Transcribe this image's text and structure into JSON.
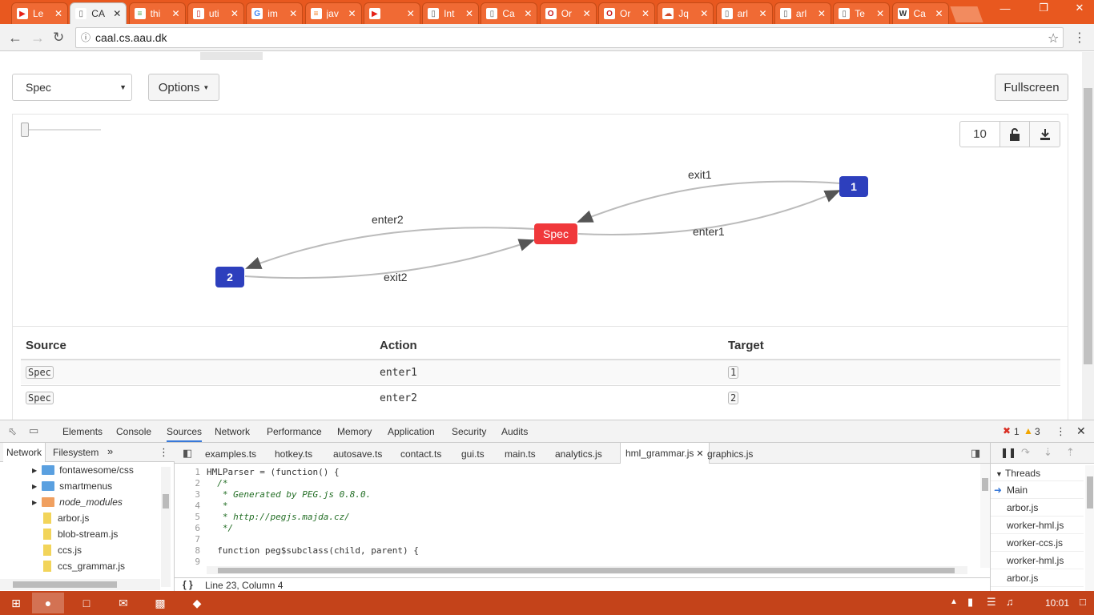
{
  "browser": {
    "tabs": [
      {
        "title": "Le",
        "icon": "youtube-icon",
        "color": "#e62117"
      },
      {
        "title": "CA",
        "icon": "page-icon",
        "color": "#666666"
      },
      {
        "title": "thi",
        "icon": "stackexchange-icon",
        "color": "#53a852"
      },
      {
        "title": "uti",
        "icon": "page-icon",
        "color": "#c8302e"
      },
      {
        "title": "im",
        "icon": "google-icon",
        "color": "#4285f4"
      },
      {
        "title": "jav",
        "icon": "stackoverflow-icon",
        "color": "#f48024"
      },
      {
        "title": "",
        "icon": "youtube-icon",
        "color": "#e62117"
      },
      {
        "title": "Int",
        "icon": "page-icon",
        "color": "#666666"
      },
      {
        "title": "Ca",
        "icon": "page-icon",
        "color": "#666666"
      },
      {
        "title": "Or",
        "icon": "opera-icon",
        "color": "#cc2020"
      },
      {
        "title": "Or",
        "icon": "opera-icon",
        "color": "#cc2020"
      },
      {
        "title": "Jq",
        "icon": "jquery-icon",
        "color": "#d04a2a"
      },
      {
        "title": "arl",
        "icon": "page-icon",
        "color": "#666666"
      },
      {
        "title": "arl",
        "icon": "page-icon",
        "color": "#666666"
      },
      {
        "title": "Te",
        "icon": "page-icon",
        "color": "#666666"
      },
      {
        "title": "Ca",
        "icon": "wikipedia-icon",
        "color": "#333333"
      }
    ],
    "url": "caal.cs.aau.dk"
  },
  "toolbar": {
    "select_value": "Spec",
    "options_label": "Options",
    "fullscreen_label": "Fullscreen",
    "depth_value": "10"
  },
  "graph": {
    "nodes": {
      "spec": "Spec",
      "n1": "1",
      "n2": "2"
    },
    "edges": {
      "exit1": "exit1",
      "enter1": "enter1",
      "enter2": "enter2",
      "exit2": "exit2"
    },
    "colors": {
      "spec": "#f0383b",
      "state": "#2d3fbd",
      "edge": "#bbbbbb"
    }
  },
  "table": {
    "headers": [
      "Source",
      "Action",
      "Target"
    ],
    "rows": [
      {
        "source": "Spec",
        "action": "enter1",
        "target": "1"
      },
      {
        "source": "Spec",
        "action": "enter2",
        "target": "2"
      }
    ]
  },
  "devtools": {
    "tabs": [
      "Elements",
      "Console",
      "Sources",
      "Network",
      "Performance",
      "Memory",
      "Application",
      "Security",
      "Audits"
    ],
    "active_tab": "Sources",
    "errors": "1",
    "warnings": "3",
    "navigator_tabs": [
      "Network",
      "Filesystem"
    ],
    "files": [
      {
        "name": "fontawesome/css",
        "type": "folder"
      },
      {
        "name": "smartmenus",
        "type": "folder"
      },
      {
        "name": "node_modules",
        "type": "folder-orange"
      },
      {
        "name": "arbor.js",
        "type": "file"
      },
      {
        "name": "blob-stream.js",
        "type": "file"
      },
      {
        "name": "ccs.js",
        "type": "file"
      },
      {
        "name": "ccs_grammar.js",
        "type": "file"
      }
    ],
    "editor_tabs": [
      "examples.ts",
      "hotkey.ts",
      "autosave.ts",
      "contact.ts",
      "gui.ts",
      "main.ts",
      "analytics.js",
      "hml_grammar.js",
      "graphics.js"
    ],
    "active_file": "hml_grammar.js",
    "code": [
      "HMLParser = (function() {",
      "  /*",
      "   * Generated by PEG.js 0.8.0.",
      "   *",
      "   * http://pegjs.majda.cz/",
      "   */",
      "",
      "  function peg$subclass(child, parent) {",
      ""
    ],
    "cursor": "Line 23, Column 4",
    "threads_label": "Threads",
    "threads": [
      "Main",
      "arbor.js",
      "worker-hml.js",
      "worker-ccs.js",
      "worker-hml.js",
      "arbor.js"
    ]
  },
  "taskbar": {
    "time": "10:01"
  }
}
